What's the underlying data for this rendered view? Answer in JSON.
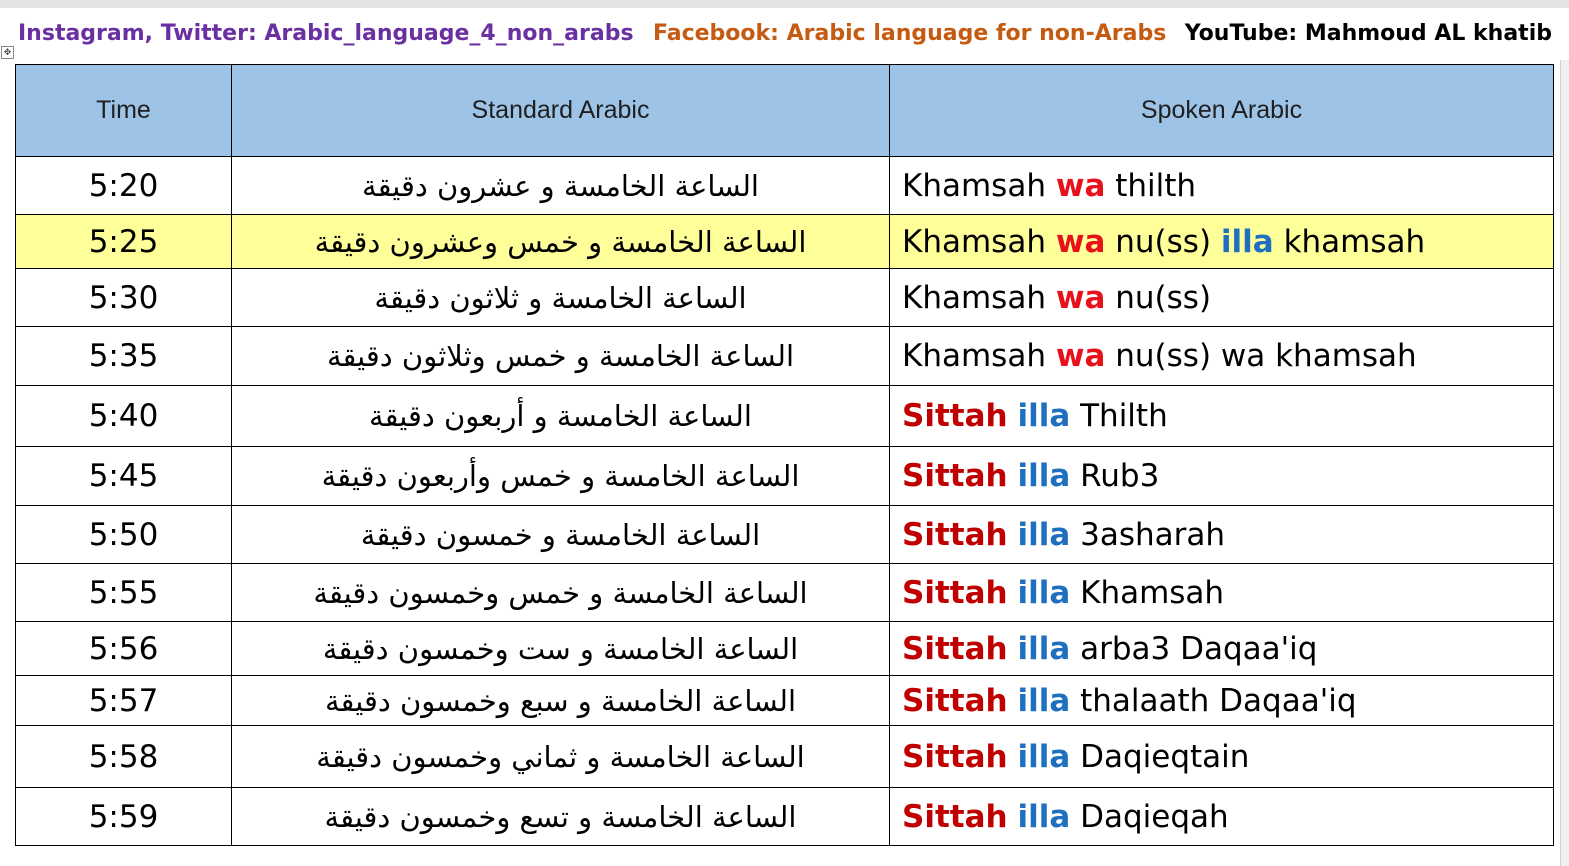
{
  "header": {
    "instagram": "Instagram, Twitter: Arabic_language_4_non_arabs",
    "facebook": "Facebook: Arabic language for non-Arabs",
    "youtube": "YouTube: Mahmoud AL khatib",
    "colors": {
      "instagram": "#6a2fa0",
      "facebook": "#c55a11",
      "youtube": "#000000"
    }
  },
  "table": {
    "columns": [
      "Time",
      "Standard Arabic",
      "Spoken Arabic"
    ],
    "header_bg": "#9dc3e6",
    "highlight_bg": "#ffff99",
    "rows": [
      {
        "time": "5:20",
        "standard": "الساعة الخامسة و عشرون دقيقة",
        "spoken": [
          "Khamsah",
          "wa",
          "thilth"
        ]
      },
      {
        "time": "5:25",
        "standard": "الساعة الخامسة و خمس وعشرون دقيقة",
        "spoken": [
          "Khamsah",
          "wa",
          "nu(ss)",
          "illa",
          "khamsah"
        ]
      },
      {
        "time": "5:30",
        "standard": "الساعة الخامسة و ثلاثون دقيقة",
        "spoken": [
          "Khamsah",
          "wa",
          "nu(ss)"
        ]
      },
      {
        "time": "5:35",
        "standard": "الساعة الخامسة و خمس وثلاثون  دقيقة",
        "spoken": [
          "Khamsah",
          "wa",
          "nu(ss) wa khamsah"
        ]
      },
      {
        "time": "5:40",
        "standard": "الساعة الخامسة و أربعون  دقيقة",
        "spoken": [
          "Sittah",
          "illa",
          "Thilth"
        ]
      },
      {
        "time": "5:45",
        "standard": "الساعة الخامسة و خمس وأربعون   دقيقة",
        "spoken": [
          "Sittah",
          "illa",
          "Rub3"
        ]
      },
      {
        "time": "5:50",
        "standard": "الساعة الخامسة و خمسون  دقيقة",
        "spoken": [
          "Sittah",
          "illa",
          "3asharah"
        ]
      },
      {
        "time": "5:55",
        "standard": "الساعة الخامسة و خمس وخمسون  دقيقة",
        "spoken": [
          "Sittah",
          "illa",
          "Khamsah"
        ]
      },
      {
        "time": "5:56",
        "standard": "الساعة الخامسة و ست وخمسون  دقيقة",
        "spoken": [
          "Sittah",
          "illa",
          "arba3 Daqaa'iq"
        ]
      },
      {
        "time": "5:57",
        "standard": "الساعة الخامسة و سبع وخمسون  دقيقة",
        "spoken": [
          "Sittah",
          "illa",
          "thalaath Daqaa'iq"
        ]
      },
      {
        "time": "5:58",
        "standard": "الساعة الخامسة و ثماني وخمسون  دقيقة",
        "spoken": [
          "Sittah",
          "illa",
          "Daqieqtain"
        ]
      },
      {
        "time": "5:59",
        "standard": "الساعة الخامسة و تسع وخمسون  دقيقة",
        "spoken": [
          "Sittah",
          "illa",
          "Daqieqah"
        ]
      }
    ]
  }
}
